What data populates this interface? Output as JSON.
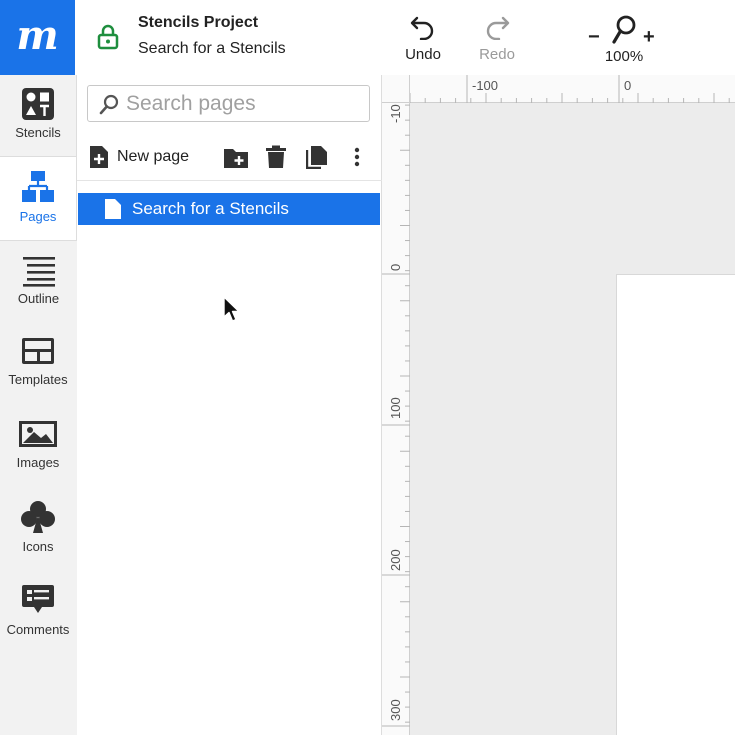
{
  "app": {
    "logo_letter": "m",
    "brand_color": "#1a73e8",
    "project_title": "Stencils Project",
    "page_subtitle": "Search for a Stencils"
  },
  "toolbar": {
    "undo_label": "Undo",
    "redo_label": "Redo",
    "zoom_minus": "−",
    "zoom_plus": "+",
    "zoom_level": "100%"
  },
  "sidebar": {
    "items": [
      {
        "label": "Stencils",
        "icon": "stencils-icon"
      },
      {
        "label": "Pages",
        "icon": "pages-icon",
        "active": true
      },
      {
        "label": "Outline",
        "icon": "outline-icon"
      },
      {
        "label": "Templates",
        "icon": "templates-icon"
      },
      {
        "label": "Images",
        "icon": "images-icon"
      },
      {
        "label": "Icons",
        "icon": "club-icon"
      },
      {
        "label": "Comments",
        "icon": "comments-icon"
      }
    ]
  },
  "pages_panel": {
    "search_placeholder": "Search pages",
    "new_page_label": "New page",
    "pages": [
      {
        "name": "Search for a Stencils",
        "selected": true
      }
    ]
  },
  "rulers": {
    "top_labels": [
      "-100",
      "0"
    ],
    "left_labels": [
      "-10",
      "0",
      "100",
      "200",
      "300"
    ]
  }
}
